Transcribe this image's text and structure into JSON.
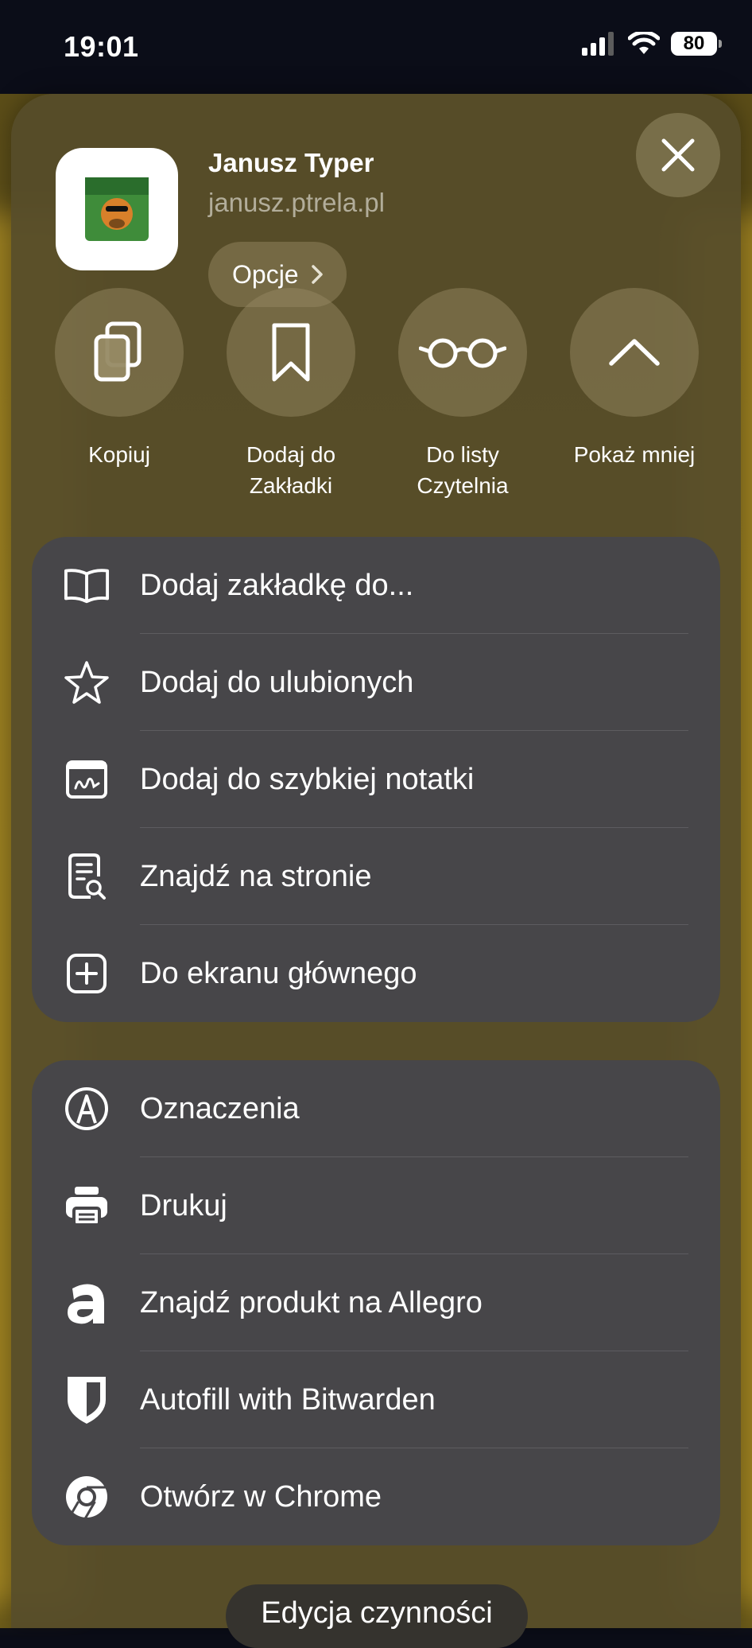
{
  "status_bar": {
    "time": "19:01",
    "battery": "80"
  },
  "share_header": {
    "app_title": "Janusz Typer",
    "url": "janusz.ptrela.pl",
    "options_label": "Opcje"
  },
  "quick_actions": [
    {
      "label": "Kopiuj",
      "icon": "copy-icon"
    },
    {
      "label": "Dodaj do Zakładki",
      "icon": "bookmark-icon"
    },
    {
      "label": "Do listy Czytelnia",
      "icon": "reading-glasses-icon"
    },
    {
      "label": "Pokaż mniej",
      "icon": "chevron-up-icon"
    }
  ],
  "menu_section_1": [
    {
      "label": "Dodaj zakładkę do...",
      "icon": "book-icon"
    },
    {
      "label": "Dodaj do ulubionych",
      "icon": "star-icon"
    },
    {
      "label": "Dodaj do szybkiej notatki",
      "icon": "quick-note-icon"
    },
    {
      "label": "Znajdź na stronie",
      "icon": "find-on-page-icon"
    },
    {
      "label": "Do ekranu głównego",
      "icon": "add-square-icon"
    }
  ],
  "menu_section_2": [
    {
      "label": "Oznaczenia",
      "icon": "markup-icon"
    },
    {
      "label": "Drukuj",
      "icon": "printer-icon"
    },
    {
      "label": "Znajdź produkt na Allegro",
      "icon": "allegro-icon"
    },
    {
      "label": "Autofill with Bitwarden",
      "icon": "bitwarden-shield-icon"
    },
    {
      "label": "Otwórz w Chrome",
      "icon": "chrome-icon"
    }
  ],
  "footer": {
    "edit_actions_label": "Edycja czynności"
  },
  "colors": {
    "sheet": "#56502a",
    "card": "#474649",
    "status_bar": "#0b0d18"
  }
}
